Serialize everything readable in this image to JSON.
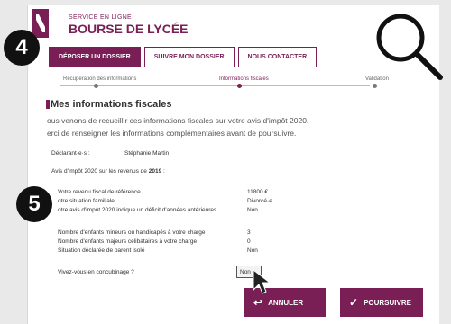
{
  "header": {
    "service_label": "SERVICE EN LIGNE",
    "title": "BOURSE DE LYCÉE"
  },
  "tabs": [
    {
      "label": "DÉPOSER UN DOSSIER",
      "active": true
    },
    {
      "label": "SUIVRE MON DOSSIER",
      "active": false
    },
    {
      "label": "NOUS CONTACTER",
      "active": false
    }
  ],
  "steps": [
    {
      "label": "Récupération des informations",
      "current": false
    },
    {
      "label": "Informations fiscales",
      "current": true
    },
    {
      "label": "Validation",
      "current": false
    }
  ],
  "section": {
    "title": "Mes informations fiscales",
    "intro_line1": "ous venons de recueillir ces informations fiscales sur votre avis d'impôt 2020.",
    "intro_line2": "erci de renseigner les informations complémentaires avant de poursuivre."
  },
  "declarant": {
    "label": "Déclarant·e·s :",
    "value": "Stéphanie Martin"
  },
  "notice": {
    "label": "Avis d'impôt 2020 sur les revenus de ",
    "year": "2019",
    "suffix": " :"
  },
  "fiscal_rows": [
    {
      "label": "Votre revenu fiscal de référence",
      "value": "11800 €"
    },
    {
      "label": "otre situation familiale",
      "value": "Divorcé·e"
    },
    {
      "label": "otre avis d'impôt 2020 indique un déficit d'années antérieures",
      "value": "Non"
    }
  ],
  "children_rows": [
    {
      "label": "Nombre d'enfants mineurs ou handicapés à votre charge",
      "value": "3"
    },
    {
      "label": "Nombre d'enfants majeurs célibataires à votre charge",
      "value": "0"
    },
    {
      "label": "Situation déclarée de parent isolé",
      "value": "Non"
    }
  ],
  "concubinage": {
    "label": "Vivez-vous en concubinage ?",
    "selected": "Non"
  },
  "buttons": {
    "cancel": "ANNULER",
    "continue": "POURSUIVRE"
  },
  "annotations": {
    "badge_top": "4",
    "badge_bottom": "5"
  },
  "colors": {
    "brand": "#7a1f56"
  },
  "icons": {
    "search": "magnifier-icon",
    "back": "arrow-left-icon",
    "check": "checkmark-icon"
  }
}
